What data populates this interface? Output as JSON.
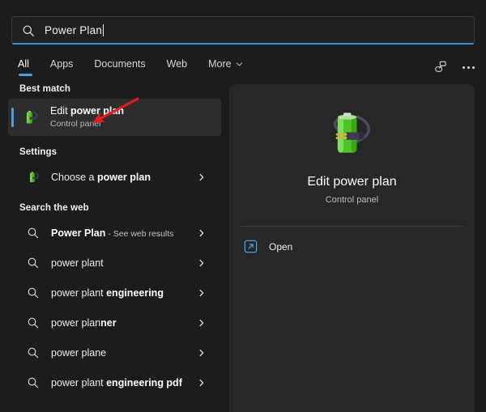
{
  "search": {
    "value": "Power Plan",
    "icon": "search-icon"
  },
  "tabs": [
    {
      "label": "All",
      "active": true
    },
    {
      "label": "Apps",
      "active": false
    },
    {
      "label": "Documents",
      "active": false
    },
    {
      "label": "Web",
      "active": false
    },
    {
      "label": "More",
      "active": false,
      "icon": "chevron-down-icon"
    }
  ],
  "toolbar": {
    "feedback_icon": "feedback-icon",
    "more_icon": "ellipsis-icon"
  },
  "sections": {
    "best_match_header": "Best match",
    "settings_header": "Settings",
    "search_web_header": "Search the web"
  },
  "best_match": {
    "title_regular": "Edit ",
    "title_bold": "power plan",
    "subtitle": "Control panel",
    "icon": "power-plan-battery-icon",
    "selected": true
  },
  "settings_results": [
    {
      "regular": "Choose a ",
      "bold": "power plan",
      "icon": "power-plan-battery-icon",
      "chevron": "chevron-right-icon"
    }
  ],
  "web_results": [
    {
      "bold": "Power Plan",
      "regular": "",
      "suffix": " - See web results",
      "icon": "search-icon",
      "chevron": "chevron-right-icon"
    },
    {
      "regular": "power plant",
      "bold": "",
      "suffix": "",
      "icon": "search-icon",
      "chevron": "chevron-right-icon"
    },
    {
      "regular": "power plant ",
      "bold": "engineering",
      "suffix": "",
      "icon": "search-icon",
      "chevron": "chevron-right-icon"
    },
    {
      "regular": "power plan",
      "bold": "ner",
      "suffix": "",
      "icon": "search-icon",
      "chevron": "chevron-right-icon"
    },
    {
      "regular": "power plane",
      "bold": "",
      "suffix": "",
      "icon": "search-icon",
      "chevron": "chevron-right-icon"
    },
    {
      "regular": "power plant ",
      "bold": "engineering pdf",
      "suffix": "",
      "icon": "search-icon",
      "chevron": "chevron-right-icon"
    }
  ],
  "preview": {
    "icon": "power-plan-battery-icon",
    "title": "Edit power plan",
    "subtitle": "Control panel",
    "action_label": "Open",
    "action_icon": "open-external-icon"
  },
  "annotation": {
    "type": "arrow",
    "color": "#e81a1a",
    "points_to": "best-match-row"
  },
  "colors": {
    "background": "#1c1c1c",
    "panel": "#272727",
    "selected_row": "#2d2d2d",
    "accent": "#4aa0e0",
    "annotation_red": "#e81a1a"
  }
}
